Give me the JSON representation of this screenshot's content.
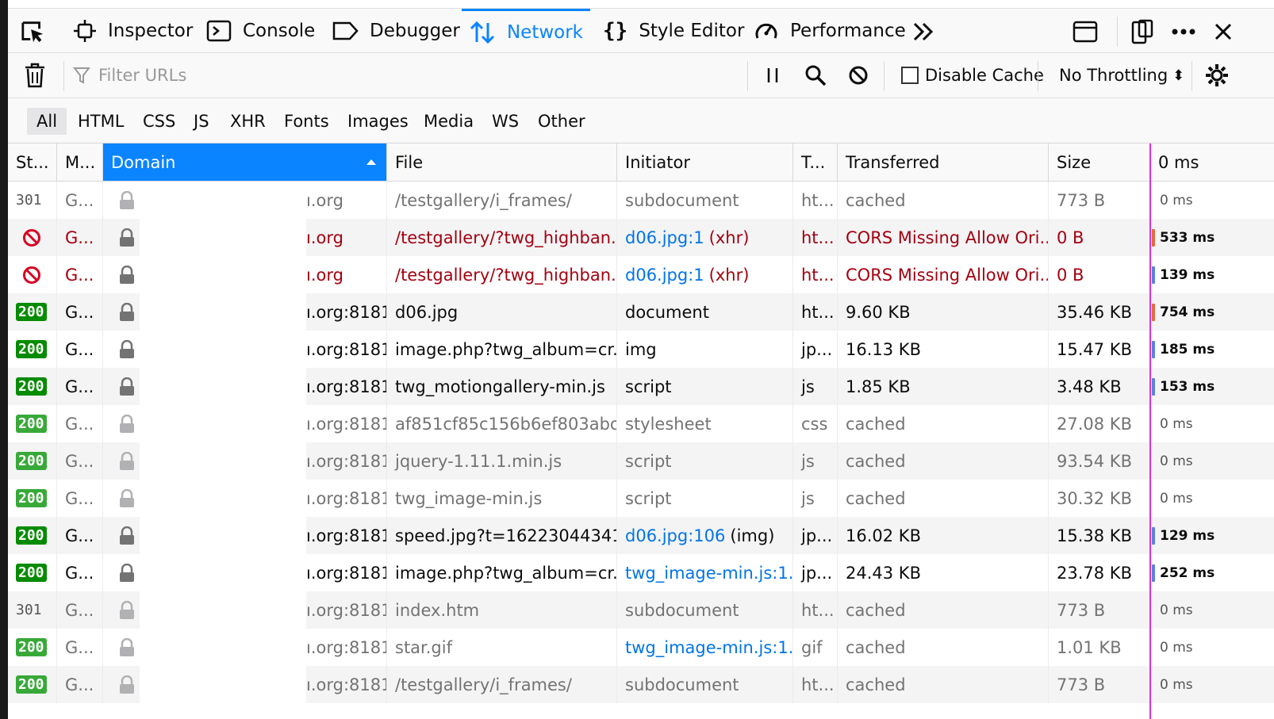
{
  "tabs": [
    {
      "label": "Inspector"
    },
    {
      "label": "Console"
    },
    {
      "label": "Debugger"
    },
    {
      "label": "Network",
      "selected": true
    },
    {
      "label": "Style Editor"
    },
    {
      "label": "Performance"
    }
  ],
  "toolbar": {
    "filter_placeholder": "Filter URLs",
    "disable_cache_label": "Disable Cache",
    "throttling_label": "No Throttling",
    "throttling_arrow": "⬍"
  },
  "type_filters": [
    "All",
    "HTML",
    "CSS",
    "JS",
    "XHR",
    "Fonts",
    "Images",
    "Media",
    "WS",
    "Other"
  ],
  "columns": {
    "status": "St...",
    "method": "M...",
    "domain": "Domain",
    "file": "File",
    "initiator": "Initiator",
    "type": "T...",
    "transferred": "Transferred",
    "size": "Size",
    "waterfall": "0 ms"
  },
  "rows": [
    {
      "status": "301",
      "badge": false,
      "method": "G...",
      "domain": "ı.org",
      "file": "/testgallery/i_frames/",
      "initiator": "subdocument",
      "initiator_extra": "",
      "type": "ht...",
      "transferred": "cached",
      "size": "773 B",
      "time": "0 ms",
      "state": "cached",
      "bar": ""
    },
    {
      "status": "blocked",
      "badge": false,
      "method": "G...",
      "domain": "ı.org",
      "file": "/testgallery/?twg_highban...",
      "initiator": "d06.jpg:1",
      "initiator_extra": "(xhr)",
      "type": "ht...",
      "transferred": "CORS Missing Allow Ori...",
      "size": "0 B",
      "time": "533 ms",
      "state": "error",
      "bar": "#e06c42"
    },
    {
      "status": "blocked",
      "badge": false,
      "method": "G...",
      "domain": "ı.org",
      "file": "/testgallery/?twg_highban...",
      "initiator": "d06.jpg:1",
      "initiator_extra": "(xhr)",
      "type": "ht...",
      "transferred": "CORS Missing Allow Ori...",
      "size": "0 B",
      "time": "139 ms",
      "state": "error",
      "bar": "#5b83d8"
    },
    {
      "status": "200",
      "badge": true,
      "method": "G...",
      "domain": "ı.org:8181",
      "file": "d06.jpg",
      "initiator": "document",
      "initiator_extra": "",
      "type": "ht...",
      "transferred": "9.60 KB",
      "size": "35.46 KB",
      "time": "754 ms",
      "state": "normal",
      "bar": "#e06c42"
    },
    {
      "status": "200",
      "badge": true,
      "method": "G...",
      "domain": "ı.org:8181",
      "file": "image.php?twg_album=cr...",
      "initiator": "img",
      "initiator_extra": "",
      "type": "jp...",
      "transferred": "16.13 KB",
      "size": "15.47 KB",
      "time": "185 ms",
      "state": "normal",
      "bar": "#5b83d8"
    },
    {
      "status": "200",
      "badge": true,
      "method": "G...",
      "domain": "ı.org:8181",
      "file": "twg_motiongallery-min.js",
      "initiator": "script",
      "initiator_extra": "",
      "type": "js",
      "transferred": "1.85 KB",
      "size": "3.48 KB",
      "time": "153 ms",
      "state": "normal",
      "bar": "#5b83d8"
    },
    {
      "status": "200",
      "badge": true,
      "method": "G...",
      "domain": "ı.org:8181",
      "file": "af851cf85c156b6ef803abc...",
      "initiator": "stylesheet",
      "initiator_extra": "",
      "type": "css",
      "transferred": "cached",
      "size": "27.08 KB",
      "time": "0 ms",
      "state": "cached",
      "bar": ""
    },
    {
      "status": "200",
      "badge": true,
      "method": "G...",
      "domain": "ı.org:8181",
      "file": "jquery-1.11.1.min.js",
      "initiator": "script",
      "initiator_extra": "",
      "type": "js",
      "transferred": "cached",
      "size": "93.54 KB",
      "time": "0 ms",
      "state": "cached",
      "bar": ""
    },
    {
      "status": "200",
      "badge": true,
      "method": "G...",
      "domain": "ı.org:8181",
      "file": "twg_image-min.js",
      "initiator": "script",
      "initiator_extra": "",
      "type": "js",
      "transferred": "cached",
      "size": "30.32 KB",
      "time": "0 ms",
      "state": "cached",
      "bar": ""
    },
    {
      "status": "200",
      "badge": true,
      "method": "G...",
      "domain": "ı.org:8181",
      "file": "speed.jpg?t=16223044341...",
      "initiator": "d06.jpg:106",
      "initiator_extra": "(img)",
      "type": "jp...",
      "transferred": "16.02 KB",
      "size": "15.38 KB",
      "time": "129 ms",
      "state": "normal",
      "bar": "#5b83d8"
    },
    {
      "status": "200",
      "badge": true,
      "method": "G...",
      "domain": "ı.org:8181",
      "file": "image.php?twg_album=cr...",
      "initiator": "twg_image-min.js:1...",
      "initiator_extra": "",
      "type": "jp...",
      "transferred": "24.43 KB",
      "size": "23.78 KB",
      "time": "252 ms",
      "state": "normal",
      "bar": "#5b83d8"
    },
    {
      "status": "301",
      "badge": false,
      "method": "G...",
      "domain": "ı.org:8181",
      "file": "index.htm",
      "initiator": "subdocument",
      "initiator_extra": "",
      "type": "ht...",
      "transferred": "cached",
      "size": "773 B",
      "time": "0 ms",
      "state": "cached",
      "bar": ""
    },
    {
      "status": "200",
      "badge": true,
      "method": "G...",
      "domain": "ı.org:8181",
      "file": "star.gif",
      "initiator": "twg_image-min.js:1...",
      "initiator_extra": "",
      "type": "gif",
      "transferred": "cached",
      "size": "1.01 KB",
      "time": "0 ms",
      "state": "cached",
      "bar": ""
    },
    {
      "status": "200",
      "badge": true,
      "method": "G...",
      "domain": "ı.org:8181",
      "file": "/testgallery/i_frames/",
      "initiator": "subdocument",
      "initiator_extra": "",
      "type": "ht...",
      "transferred": "cached",
      "size": "773 B",
      "time": "0 ms",
      "state": "cached",
      "bar": ""
    }
  ],
  "colors": {
    "accent": "#0a84ff",
    "status_ok": "#058b00",
    "status_ok_cached": "#38a939",
    "error_text": "#a4000f",
    "blocked_icon": "#d70022",
    "waterfall_line": "#e22fd4"
  }
}
